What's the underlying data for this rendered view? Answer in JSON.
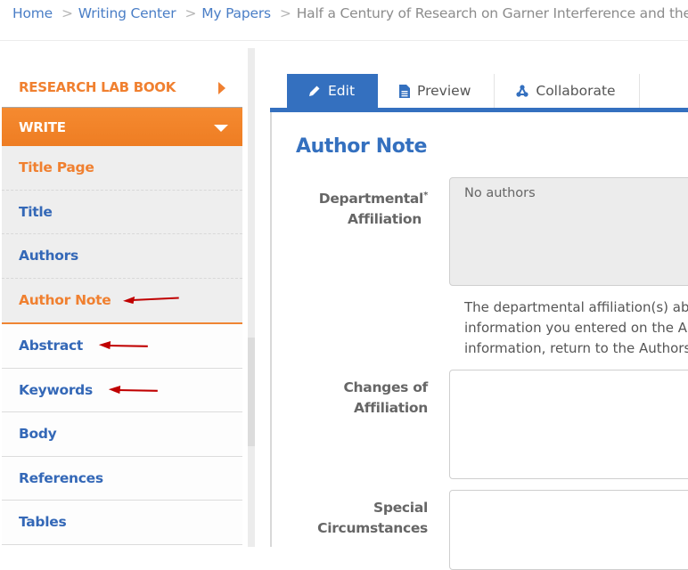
{
  "breadcrumb": {
    "items": [
      "Home",
      "Writing Center",
      "My Papers"
    ],
    "current": "Half a Century of Research on Garner Interference and the",
    "separator": ">"
  },
  "sidebar": {
    "research_lab_book": "RESEARCH LAB BOOK",
    "write": "WRITE",
    "write_subitems": [
      "Title Page",
      "Title",
      "Authors",
      "Author Note"
    ],
    "items": [
      "Abstract",
      "Keywords",
      "Body",
      "References",
      "Tables"
    ]
  },
  "tabs": [
    {
      "label": "Edit",
      "icon": "pencil-icon",
      "active": true
    },
    {
      "label": "Preview",
      "icon": "document-icon",
      "active": false
    },
    {
      "label": "Collaborate",
      "icon": "collaborate-icon",
      "active": false
    }
  ],
  "content": {
    "title": "Author Note",
    "fields": [
      {
        "label_line1": "Departmental",
        "label_line2": "Affiliation",
        "required": "*",
        "value": "No authors"
      },
      {
        "label_line1": "Changes of",
        "label_line2": "Affiliation",
        "value": ""
      },
      {
        "label_line1": "Special",
        "label_line2": "Circumstances",
        "value": ""
      }
    ],
    "help_lines": [
      "The departmental affiliation(s) above",
      "information you entered on the Authors",
      "information, return to the Authors"
    ]
  },
  "colors": {
    "brand_orange": "#f08030",
    "brand_blue": "#3470bf",
    "annotation_arrow": "#c00000"
  }
}
